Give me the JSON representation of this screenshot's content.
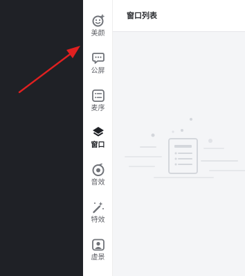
{
  "sidebar": {
    "items": [
      {
        "label": "美颜",
        "icon": "face-beauty-icon",
        "active": false
      },
      {
        "label": "公屏",
        "icon": "chat-bubble-icon",
        "active": false
      },
      {
        "label": "麦序",
        "icon": "list-order-icon",
        "active": false
      },
      {
        "label": "窗口",
        "icon": "layers-icon",
        "active": true
      },
      {
        "label": "音效",
        "icon": "sound-disc-icon",
        "active": false
      },
      {
        "label": "特效",
        "icon": "magic-wand-icon",
        "active": false
      },
      {
        "label": "虚景",
        "icon": "virtual-background-icon",
        "active": false
      }
    ]
  },
  "panel": {
    "title": "窗口列表",
    "empty_icon": "empty-document-icon"
  },
  "annotation": {
    "arrow_color": "#e02020"
  },
  "colors": {
    "dark_background": "#1f2126",
    "sidebar_background": "#ffffff",
    "panel_background": "#f4f5f7",
    "icon_color": "#6f7278",
    "active_icon_color": "#1f2126",
    "illustration_color": "#d4d7dc"
  }
}
